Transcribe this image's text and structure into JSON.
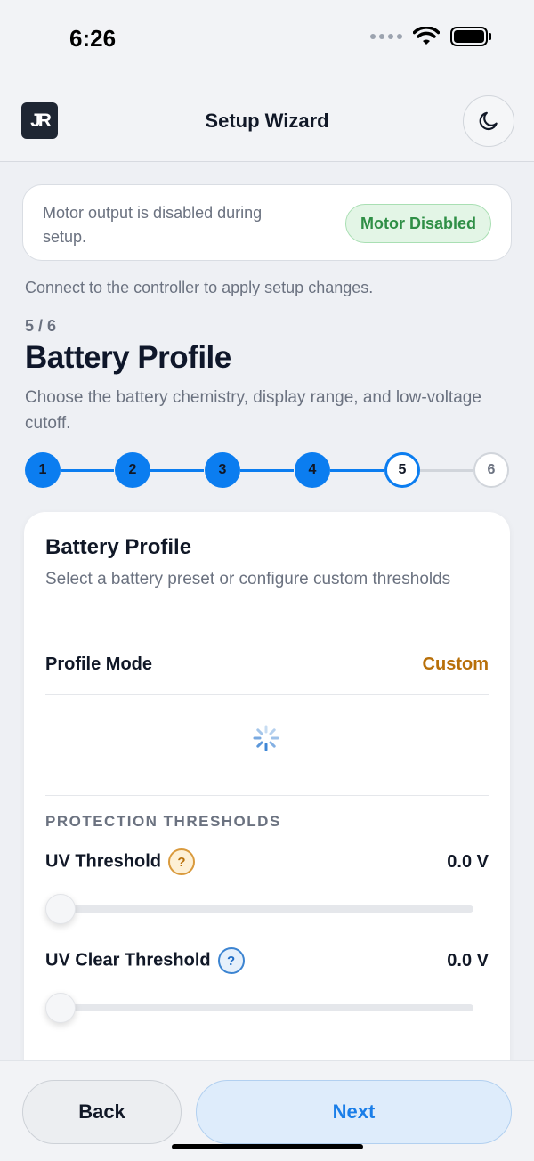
{
  "status": {
    "time": "6:26"
  },
  "header": {
    "logo": "JR",
    "title": "Setup Wizard",
    "theme_icon": "moon-icon"
  },
  "notice": {
    "text": "Motor output is disabled during setup.",
    "badge": "Motor Disabled"
  },
  "connect_text": "Connect to the controller to apply setup changes.",
  "wizard": {
    "step_count": "5 / 6",
    "title": "Battery Profile",
    "description": "Choose the battery chemistry, display range, and low-voltage cutoff.",
    "steps": [
      "1",
      "2",
      "3",
      "4",
      "5",
      "6"
    ],
    "current_step": 5
  },
  "card": {
    "title": "Battery Profile",
    "subtitle": "Select a battery preset or configure custom thresholds",
    "profile_mode_label": "Profile Mode",
    "profile_mode_value": "Custom",
    "section_label": "PROTECTION THRESHOLDS",
    "thresholds": [
      {
        "label": "UV Threshold",
        "help": "?",
        "value": "0.0 V",
        "slider_fraction": 0
      },
      {
        "label": "UV Clear Threshold",
        "help": "?",
        "value": "0.0 V",
        "slider_fraction": 0
      }
    ]
  },
  "footer": {
    "back_label": "Back",
    "next_label": "Next"
  },
  "colors": {
    "accent": "#0b7df0",
    "custom": "#b8700a",
    "badge_green": "#2f8f46"
  }
}
